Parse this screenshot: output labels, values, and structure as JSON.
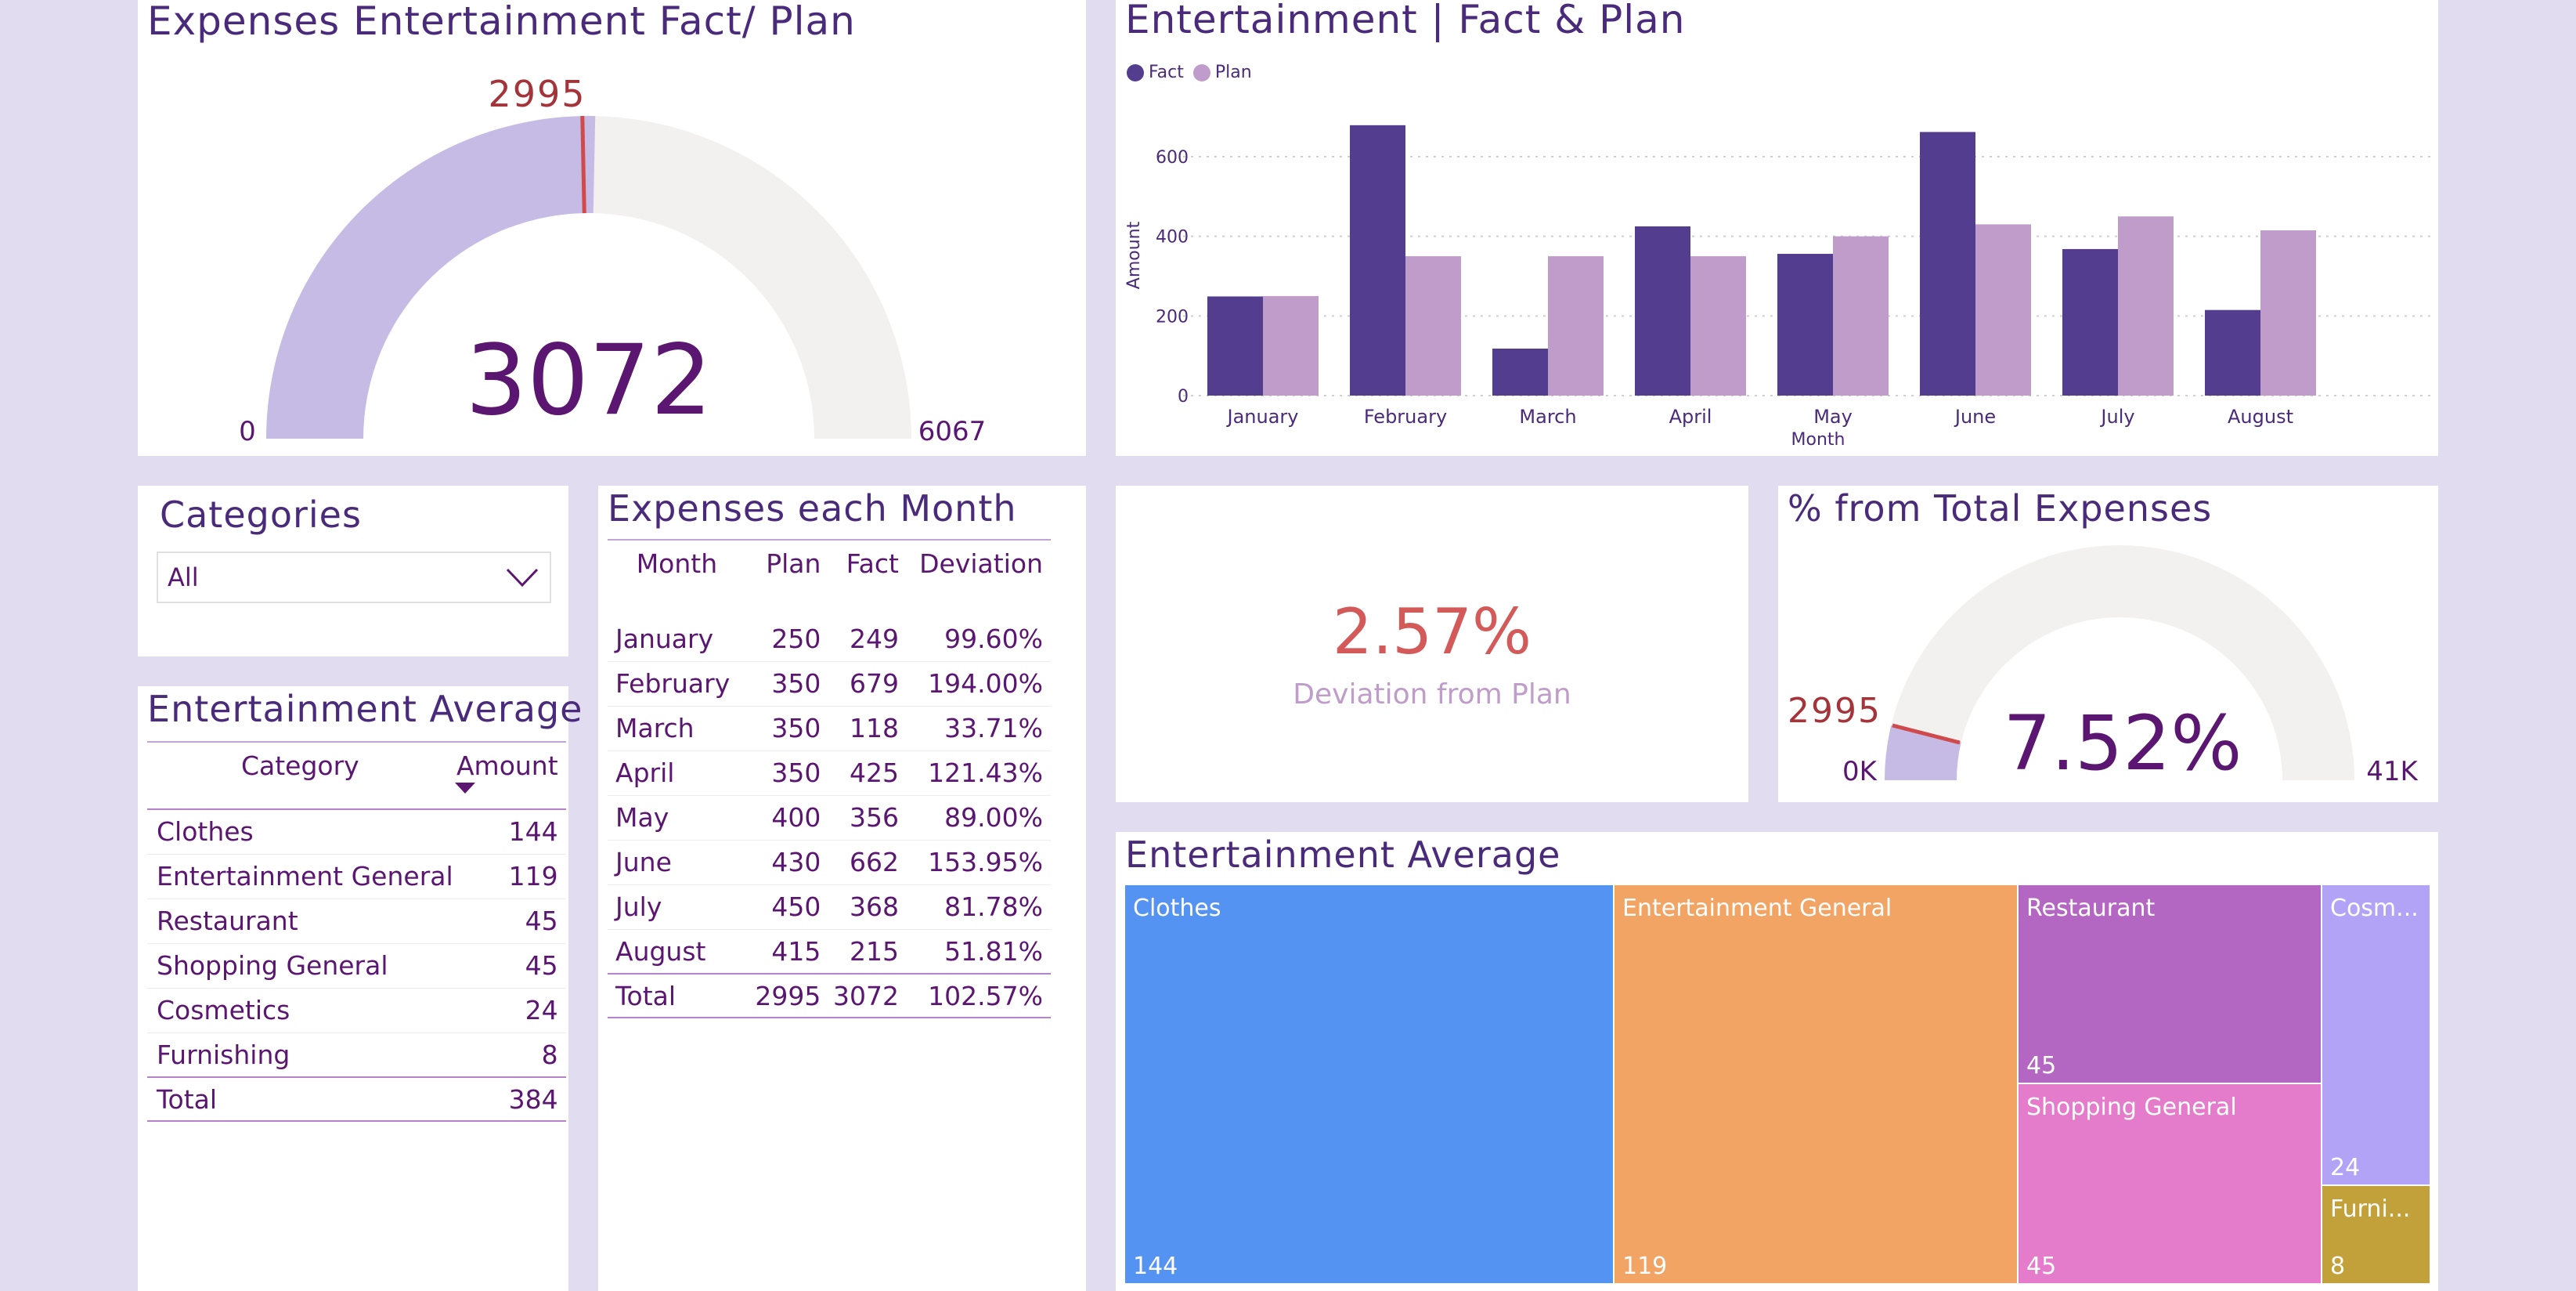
{
  "colors": {
    "fact": "#523d8e",
    "plan": "#bf9cca",
    "gauge_fill": "#c6bbe4",
    "gauge_bg": "#f2f1f0",
    "target_line": "#d0494b",
    "dark_purple": "#5a1670",
    "red_text": "#a4343a",
    "deviation_red": "#d45a5a",
    "deviation_label": "#bf9cca"
  },
  "gauge_main": {
    "title": "Expenses Entertainment Fact/ Plan",
    "target_label": "2995",
    "value_label": "3072",
    "min_label": "0",
    "max_label": "6067",
    "value": 3072,
    "target": 2995,
    "min": 0,
    "max": 6067
  },
  "bar_chart": {
    "title": "Entertainment | Fact & Plan",
    "legend_fact": "Fact",
    "legend_plan": "Plan",
    "ylabel": "Amount",
    "xlabel": "Month",
    "y_ticks": [
      "0",
      "200",
      "400",
      "600"
    ]
  },
  "chart_data": {
    "type": "bar",
    "title": "Entertainment | Fact & Plan",
    "xlabel": "Month",
    "ylabel": "Amount",
    "categories": [
      "January",
      "February",
      "March",
      "April",
      "May",
      "June",
      "July",
      "August"
    ],
    "series": [
      {
        "name": "Fact",
        "values": [
          249,
          679,
          118,
          425,
          356,
          662,
          368,
          215
        ]
      },
      {
        "name": "Plan",
        "values": [
          250,
          350,
          350,
          350,
          400,
          430,
          450,
          415
        ]
      }
    ],
    "ylim": [
      0,
      700
    ],
    "grid": true,
    "legend": "top-left"
  },
  "categories_slicer": {
    "title": "Categories",
    "selected": "All"
  },
  "month_table": {
    "title": "Expenses each Month",
    "headers": [
      "Month",
      "Plan",
      "Fact",
      "Deviation"
    ],
    "rows": [
      [
        "January",
        "250",
        "249",
        "99.60%"
      ],
      [
        "February",
        "350",
        "679",
        "194.00%"
      ],
      [
        "March",
        "350",
        "118",
        "33.71%"
      ],
      [
        "April",
        "350",
        "425",
        "121.43%"
      ],
      [
        "May",
        "400",
        "356",
        "89.00%"
      ],
      [
        "June",
        "430",
        "662",
        "153.95%"
      ],
      [
        "July",
        "450",
        "368",
        "81.78%"
      ],
      [
        "August",
        "415",
        "215",
        "51.81%"
      ]
    ],
    "total": [
      "Total",
      "2995",
      "3072",
      "102.57%"
    ]
  },
  "avg_table": {
    "title": "Entertainment Average",
    "headers": [
      "Category",
      "Amount"
    ],
    "rows": [
      [
        "Clothes",
        "144"
      ],
      [
        "Entertainment General",
        "119"
      ],
      [
        "Restaurant",
        "45"
      ],
      [
        "Shopping General",
        "45"
      ],
      [
        "Cosmetics",
        "24"
      ],
      [
        "Furnishing",
        "8"
      ]
    ],
    "total": [
      "Total",
      "384"
    ]
  },
  "deviation_card": {
    "value": "2.57%",
    "label": "Deviation from Plan"
  },
  "gauge_pct": {
    "title": "% from Total Expenses",
    "value_label": "7.52%",
    "target_label": "2995",
    "min_label": "0K",
    "max_label": "41K",
    "value_fraction": 0.0752
  },
  "treemap": {
    "title": "Entertainment Average",
    "tiles": [
      {
        "label": "Clothes",
        "value": "144",
        "color": "#5593f3"
      },
      {
        "label": "Entertainment General",
        "value": "119",
        "color": "#f2a464"
      },
      {
        "label": "Restaurant",
        "value": "45",
        "color": "#b466c3"
      },
      {
        "label": "Shopping General",
        "value": "45",
        "color": "#e57bcb"
      },
      {
        "label": "Cosm...",
        "value": "24",
        "color": "#b3a3f6"
      },
      {
        "label": "Furni...",
        "value": "8",
        "color": "#c2a03a"
      }
    ]
  }
}
